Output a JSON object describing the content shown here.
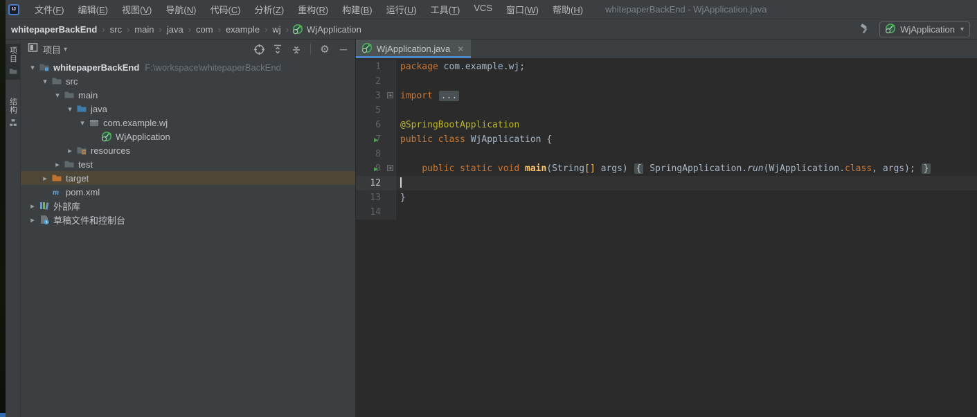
{
  "colors": {
    "panel_bg": "#3c3f41",
    "editor_bg": "#2b2b2b",
    "gutter_bg": "#313335",
    "caret_line_bg": "#323232",
    "selection_bg": "#4e4738",
    "tab_underline": "#4a88c7",
    "keyword": "#cc7832",
    "annotation": "#bbb529",
    "method_decl": "#ffc66b",
    "code_fg": "#a9b7c6",
    "line_number": "#606366",
    "run_arrow_green": "#4da54f",
    "spring_green": "#62b543",
    "maven_blue": "#5ea2d8",
    "excluded_folder_orange": "#c0722f"
  },
  "window": {
    "logo_text": "IJ",
    "title": "whitepaperBackEnd - WjApplication.java"
  },
  "menu": {
    "items": [
      "文件(F)",
      "编辑(E)",
      "视图(V)",
      "导航(N)",
      "代码(C)",
      "分析(Z)",
      "重构(R)",
      "构建(B)",
      "运行(U)",
      "工具(T)",
      "VCS",
      "窗口(W)",
      "帮助(H)"
    ]
  },
  "breadcrumbs": {
    "segments": [
      "whitepaperBackEnd",
      "src",
      "main",
      "java",
      "com",
      "example",
      "wj"
    ],
    "leaf": {
      "icon": "spring-boot-run",
      "label": "WjApplication"
    }
  },
  "nav_actions": {
    "build_icon": "build-hammer",
    "run_config": {
      "icon": "spring-boot-run",
      "label": "WjApplication",
      "dropdown": "▾"
    }
  },
  "tool_stripe": {
    "buttons": [
      {
        "label": "项目",
        "icon": "folder",
        "selected": true
      },
      {
        "label": "结构",
        "icon": "structure",
        "selected": false
      }
    ]
  },
  "project_panel": {
    "header": {
      "icon": "tool-window-project",
      "title": "项目",
      "dropdown": "▾",
      "actions": [
        "locate",
        "expand-all",
        "collapse-all",
        "divider",
        "settings",
        "hide"
      ]
    },
    "tree": [
      {
        "label": "whitepaperBackEnd",
        "path": "F:\\workspace\\whitepaperBackEnd",
        "icon": "project-folder",
        "chevron": "expanded",
        "indent": 0,
        "bold": true
      },
      {
        "label": "src",
        "icon": "folder",
        "chevron": "expanded",
        "indent": 1
      },
      {
        "label": "main",
        "icon": "folder",
        "chevron": "expanded",
        "indent": 2
      },
      {
        "label": "java",
        "icon": "source-folder",
        "chevron": "expanded",
        "indent": 3
      },
      {
        "label": "com.example.wj",
        "icon": "package",
        "chevron": "expanded",
        "indent": 4
      },
      {
        "label": "WjApplication",
        "icon": "spring-boot-run",
        "chevron": "none",
        "indent": 5
      },
      {
        "label": "resources",
        "icon": "resources-folder",
        "chevron": "collapsed",
        "indent": 3
      },
      {
        "label": "test",
        "icon": "folder",
        "chevron": "collapsed",
        "indent": 2
      },
      {
        "label": "target",
        "icon": "excluded-folder",
        "chevron": "collapsed",
        "indent": 1,
        "selected": true
      },
      {
        "label": "pom.xml",
        "icon": "maven",
        "chevron": "none",
        "indent": 1
      },
      {
        "label": "外部库",
        "icon": "libraries",
        "chevron": "collapsed",
        "indent": 0
      },
      {
        "label": "草稿文件和控制台",
        "icon": "scratches",
        "chevron": "collapsed",
        "indent": 0
      }
    ]
  },
  "editor": {
    "tab": {
      "icon": "spring-boot-run",
      "title": "WjApplication.java",
      "close": "✕"
    },
    "lines": [
      {
        "num": "1",
        "tokens": [
          {
            "t": "package ",
            "c": "kw"
          },
          {
            "t": "com.example.wj;",
            "c": "def"
          }
        ]
      },
      {
        "num": "2",
        "tokens": []
      },
      {
        "num": "3",
        "fold": true,
        "tokens": [
          {
            "t": "import ",
            "c": "kw"
          },
          {
            "t": "...",
            "c": "fold"
          }
        ]
      },
      {
        "num": "5",
        "tokens": []
      },
      {
        "num": "6",
        "tokens": [
          {
            "t": "@SpringBootApplication",
            "c": "ann"
          }
        ]
      },
      {
        "num": "7",
        "run": true,
        "tokens": [
          {
            "t": "public class ",
            "c": "kw"
          },
          {
            "t": "WjApplication {",
            "c": "def"
          }
        ]
      },
      {
        "num": "8",
        "tokens": []
      },
      {
        "num": "9",
        "run": true,
        "fold": true,
        "tokens": [
          {
            "t": "    ",
            "c": "def"
          },
          {
            "t": "public static void ",
            "c": "kw"
          },
          {
            "t": "main",
            "c": "meth"
          },
          {
            "t": "(String",
            "c": "def"
          },
          {
            "t": "[]",
            "c": "br"
          },
          {
            "t": " args) ",
            "c": "def"
          },
          {
            "t": "{",
            "c": "fold"
          },
          {
            "t": " SpringApplication.",
            "c": "def"
          },
          {
            "t": "run",
            "c": "itm"
          },
          {
            "t": "(WjApplication.",
            "c": "def"
          },
          {
            "t": "class",
            "c": "kw"
          },
          {
            "t": ", args); ",
            "c": "def"
          },
          {
            "t": "}",
            "c": "fold"
          }
        ]
      },
      {
        "num": "12",
        "caret": true,
        "tokens": []
      },
      {
        "num": "13",
        "tokens": [
          {
            "t": "}",
            "c": "def"
          }
        ]
      },
      {
        "num": "14",
        "tokens": []
      }
    ]
  }
}
